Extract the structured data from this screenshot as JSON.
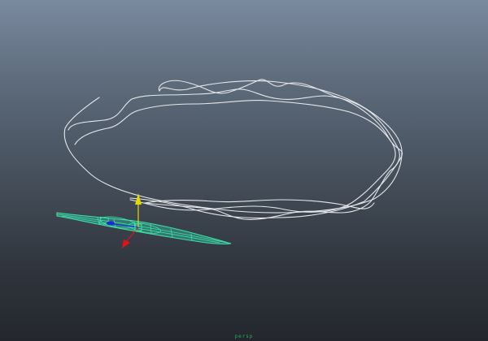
{
  "viewport": {
    "camera_label": "persp",
    "colors": {
      "background_top": "#7a8a9f",
      "background_bottom": "#23272d",
      "curve": "#e6e8ea",
      "selected_mesh": "#3ee0a8",
      "gizmo_y_axis": "#e6d800",
      "gizmo_x_axis": "#e01414",
      "gizmo_z_axis": "#1a2bd8",
      "camera_label": "#1fb561"
    }
  }
}
